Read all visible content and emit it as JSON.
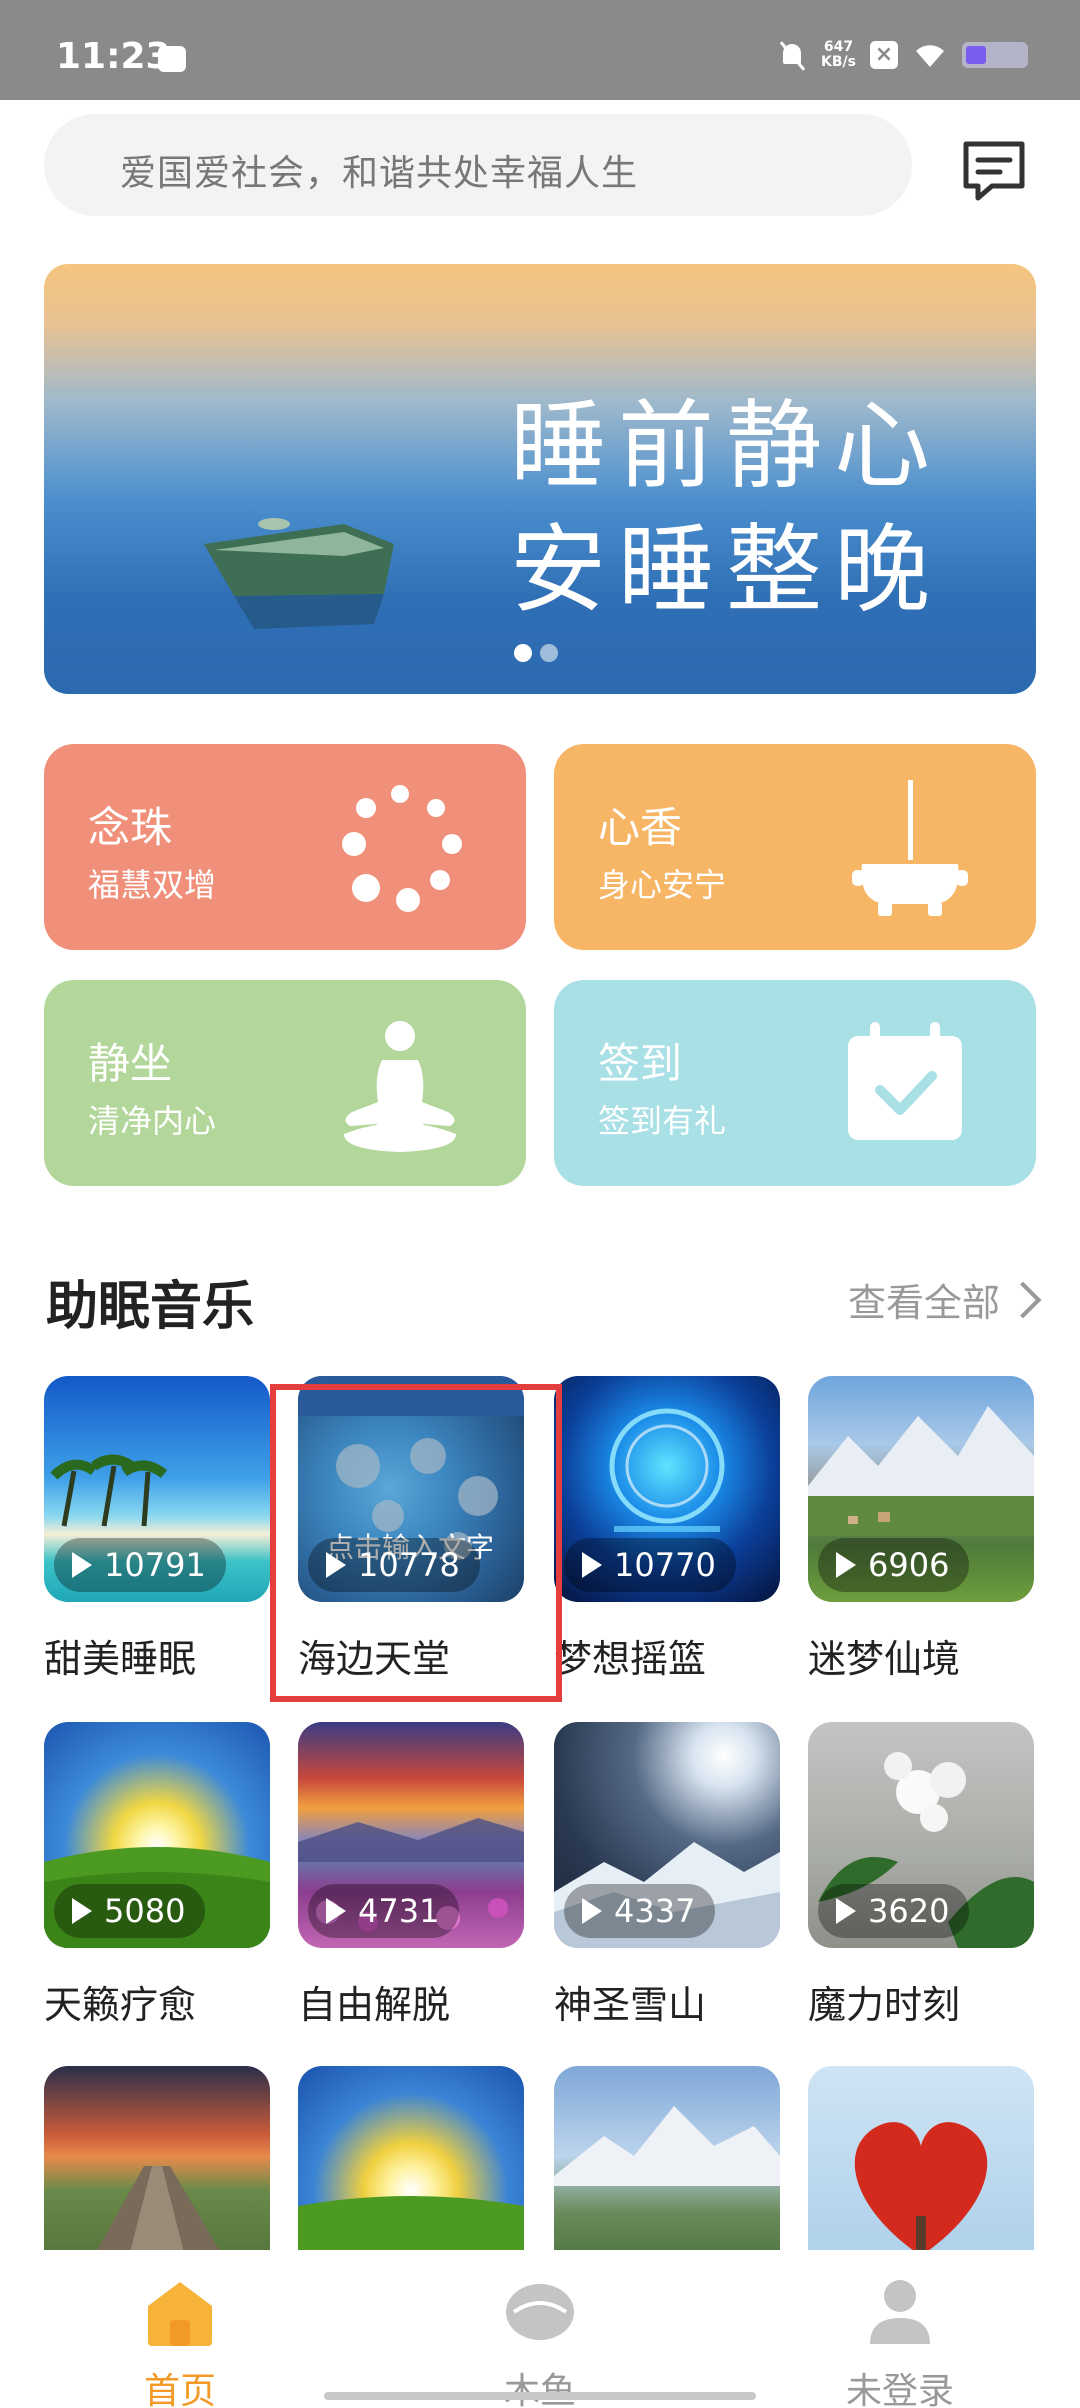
{
  "status_bar": {
    "time": "11:23",
    "net_speed_value": "647",
    "net_speed_unit": "KB/s",
    "x_badge": "×",
    "battery_level": 0.35,
    "accent": "#7b5cf0"
  },
  "search": {
    "placeholder": "爱国爱社会，和谐共处幸福人生",
    "message_icon": "message-icon"
  },
  "banner": {
    "line1": "睡前静心",
    "line2": "安睡整晚",
    "slides": 2,
    "active_slide": 0
  },
  "features": [
    {
      "title": "念珠",
      "subtitle": "福慧双增",
      "icon": "prayer-beads-icon",
      "color": "#f0907a"
    },
    {
      "title": "心香",
      "subtitle": "身心安宁",
      "icon": "incense-burner-icon",
      "color": "#f7b666"
    },
    {
      "title": "静坐",
      "subtitle": "清净内心",
      "icon": "meditation-icon",
      "color": "#b3d79a"
    },
    {
      "title": "签到",
      "subtitle": "签到有礼",
      "icon": "calendar-check-icon",
      "color": "#a9e0e6"
    }
  ],
  "music": {
    "section_title": "助眠音乐",
    "see_all": "查看全部",
    "items": [
      {
        "name": "甜美睡眠",
        "plays": "10791"
      },
      {
        "name": "海边天堂",
        "plays": "10778",
        "overlay_text": "点击输入文字"
      },
      {
        "name": "梦想摇篮",
        "plays": "10770"
      },
      {
        "name": "迷梦仙境",
        "plays": "6906"
      },
      {
        "name": "天籁疗愈",
        "plays": "5080"
      },
      {
        "name": "自由解脱",
        "plays": "4731"
      },
      {
        "name": "神圣雪山",
        "plays": "4337"
      },
      {
        "name": "魔力时刻",
        "plays": "3620"
      }
    ]
  },
  "bottom_nav": {
    "items": [
      {
        "label": "首页",
        "icon": "home-icon",
        "active": true
      },
      {
        "label": "木鱼",
        "icon": "wooden-fish-icon",
        "active": false
      },
      {
        "label": "未登录",
        "icon": "user-icon",
        "active": false
      }
    ],
    "active_color": "#f29a25"
  }
}
